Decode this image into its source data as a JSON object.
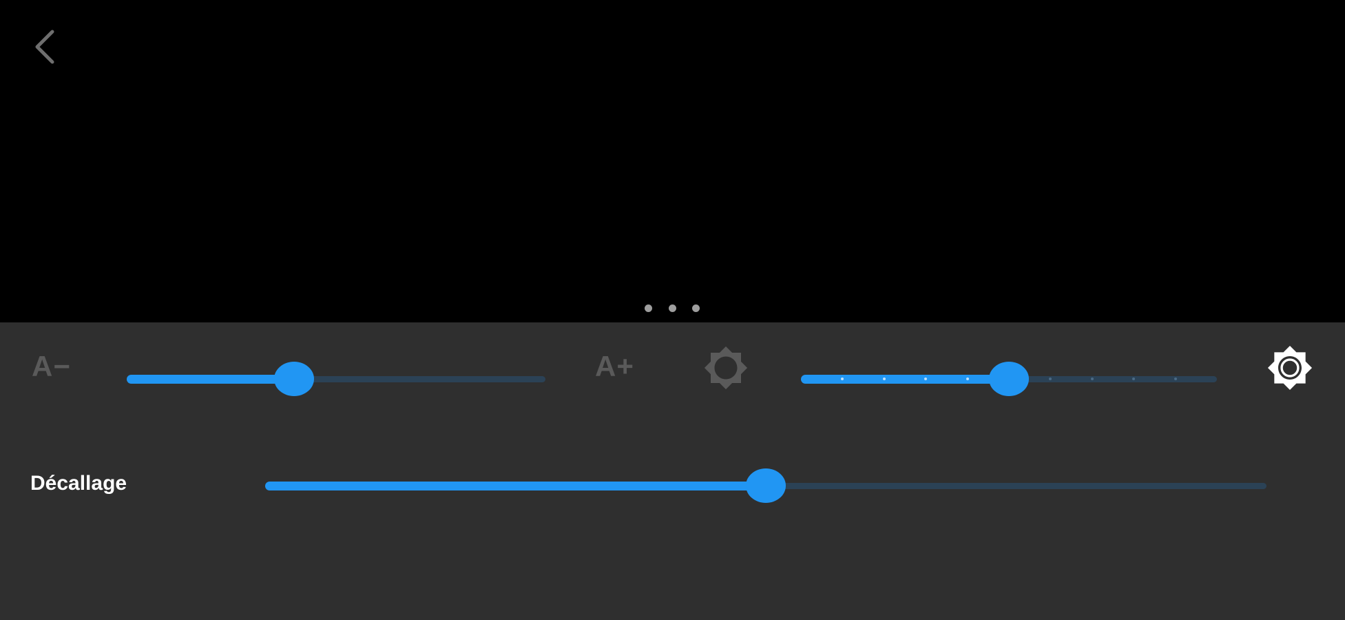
{
  "colors": {
    "background_top": "#000000",
    "panel_background": "#2f2f2f",
    "accent": "#2196f3",
    "track_inactive": "#2b4256",
    "muted_label": "#5a5a5a",
    "icon_dim": "#5a5a5a",
    "icon_bright": "#ffffff",
    "text": "#ffffff"
  },
  "header": {
    "back_icon": "chevron-left-icon",
    "handle_icon": "more-horiz-icon"
  },
  "panel": {
    "font_size": {
      "decrease_label": "A−",
      "increase_label": "A+",
      "value_fraction": 0.4
    },
    "brightness": {
      "low_icon": "brightness-low-icon",
      "high_icon": "brightness-high-icon",
      "value_fraction": 0.5,
      "steps": 10
    },
    "offset": {
      "label": "Décallage",
      "value_fraction": 0.5
    }
  }
}
